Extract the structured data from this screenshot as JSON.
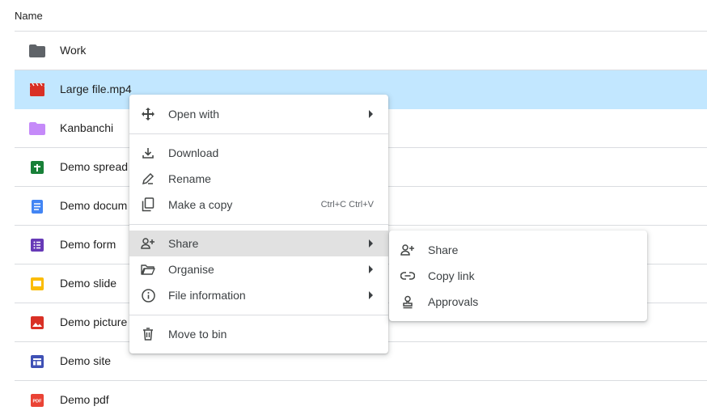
{
  "header": {
    "name_label": "Name"
  },
  "files": [
    {
      "name": "Work",
      "icon": "folder-icon",
      "color": "#5f6368"
    },
    {
      "name": "Large file.mp4",
      "icon": "video-icon",
      "color": "#d93025"
    },
    {
      "name": "Kanbanchi",
      "icon": "folder-icon",
      "color": "#c58af9"
    },
    {
      "name": "Demo spread",
      "icon": "sheets-icon",
      "color": "#188038"
    },
    {
      "name": "Demo docum",
      "icon": "docs-icon",
      "color": "#4285f4"
    },
    {
      "name": "Demo form",
      "icon": "forms-icon",
      "color": "#673ab7"
    },
    {
      "name": "Demo slide",
      "icon": "slides-icon",
      "color": "#fbbc04"
    },
    {
      "name": "Demo picture",
      "icon": "image-icon",
      "color": "#d93025"
    },
    {
      "name": "Demo site",
      "icon": "sites-icon",
      "color": "#3f51b5"
    },
    {
      "name": "Demo pdf",
      "icon": "pdf-icon",
      "color": "#ea4335"
    }
  ],
  "selected_index": 1,
  "context_menu": {
    "open_with": "Open with",
    "download": "Download",
    "rename": "Rename",
    "make_copy": "Make a copy",
    "make_copy_shortcut": "Ctrl+C Ctrl+V",
    "share": "Share",
    "organise": "Organise",
    "file_information": "File information",
    "move_to_bin": "Move to bin"
  },
  "share_submenu": {
    "share": "Share",
    "copy_link": "Copy link",
    "approvals": "Approvals"
  },
  "colors": {
    "selection": "#c2e7ff",
    "menu_hover": "#e1e1e1",
    "divider": "#dadce0"
  }
}
